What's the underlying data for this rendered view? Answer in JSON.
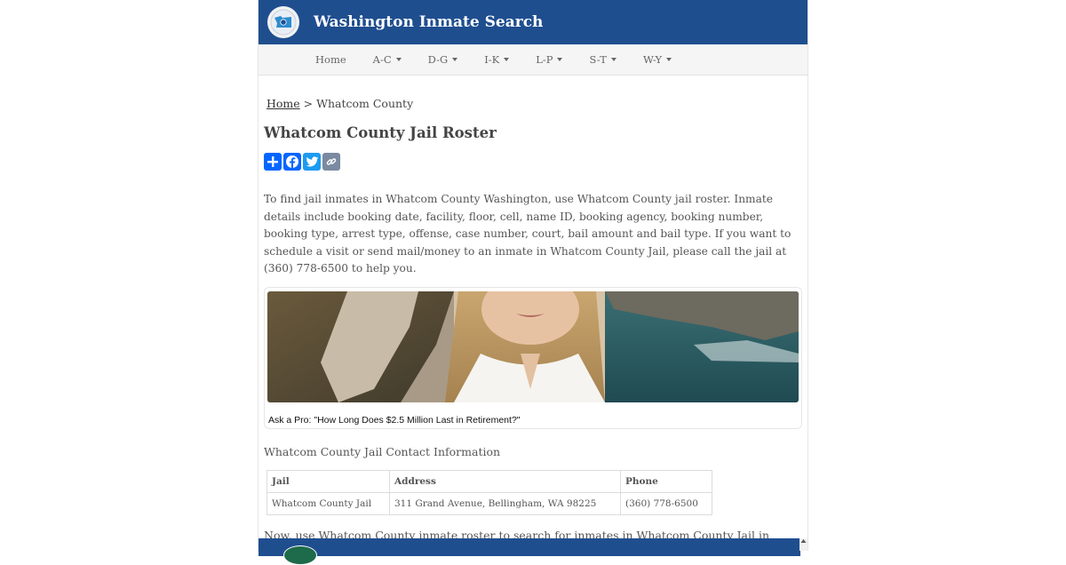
{
  "site": {
    "title": "Washington Inmate Search",
    "logo_icon": "washington-state-seal-icon"
  },
  "nav": {
    "items": [
      {
        "label": "Home",
        "dropdown": false
      },
      {
        "label": "A-C",
        "dropdown": true
      },
      {
        "label": "D-G",
        "dropdown": true
      },
      {
        "label": "I-K",
        "dropdown": true
      },
      {
        "label": "L-P",
        "dropdown": true
      },
      {
        "label": "S-T",
        "dropdown": true
      },
      {
        "label": "W-Y",
        "dropdown": true
      }
    ]
  },
  "breadcrumb": {
    "home": "Home",
    "separator": ">",
    "current": "Whatcom County"
  },
  "page_title": "Whatcom County Jail Roster",
  "share": {
    "buttons": [
      {
        "icon": "share-plus-icon",
        "color": "#0166ff"
      },
      {
        "icon": "facebook-icon",
        "color": "#0866ff"
      },
      {
        "icon": "twitter-icon",
        "color": "#1d9bf0"
      },
      {
        "icon": "copy-link-icon",
        "color": "#7a8aa0"
      }
    ]
  },
  "intro_text": "To find jail inmates in Whatcom County Washington, use Whatcom County jail roster. Inmate details include booking date, facility, floor, cell, name ID, booking agency, booking number, booking type, arrest type, offense, case number, court, bail amount and bail type. If you want to schedule a visit or send mail/money to an inmate in Whatcom County Jail, please call the jail at (360) 778-6500 to help you.",
  "ad": {
    "caption": "Ask a Pro: \"How Long Does $2.5 Million Last in Retirement?\""
  },
  "contact_heading": "Whatcom County Jail Contact Information",
  "contact_table": {
    "headers": [
      "Jail",
      "Address",
      "Phone"
    ],
    "rows": [
      [
        "Whatcom County Jail",
        "311 Grand Avenue, Bellingham, WA 98225",
        "(360) 778-6500"
      ]
    ]
  },
  "outro_text": "Now, use Whatcom County inmate roster to search for inmates in Whatcom County Jail in Washington.",
  "colors": {
    "header_bg": "#1f4e8f",
    "nav_bg": "#f5f5f5"
  }
}
